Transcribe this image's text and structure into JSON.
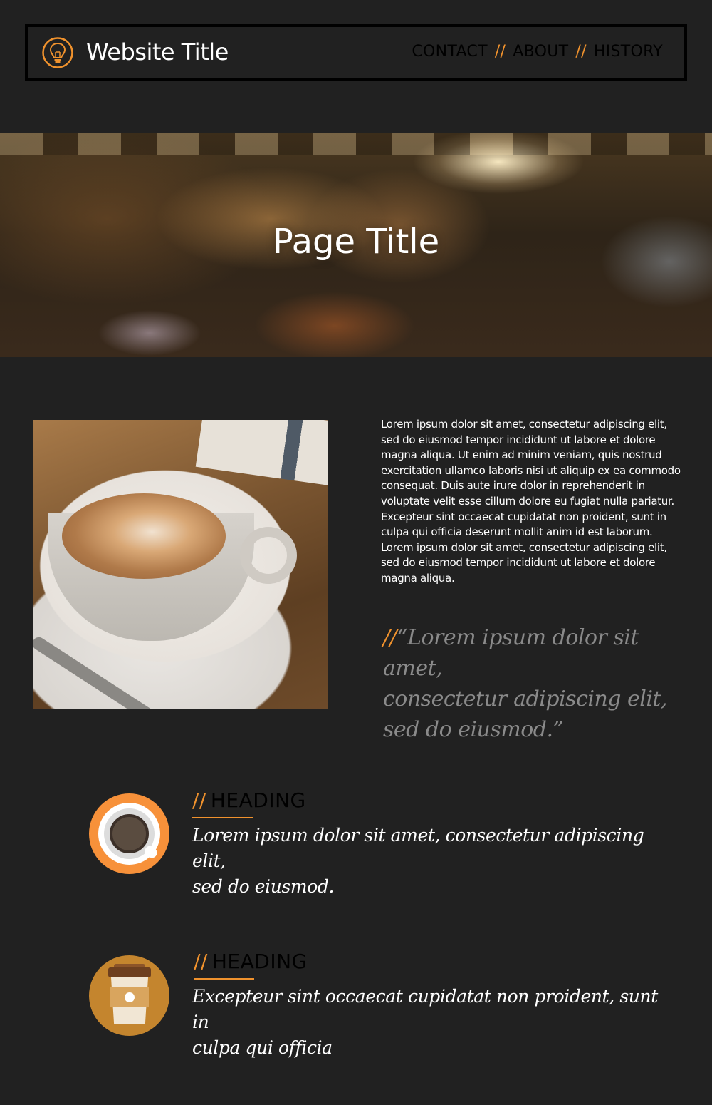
{
  "header": {
    "logo_icon": "lightbulb-icon",
    "site_title": "Website Title",
    "nav": {
      "items": [
        "CONTACT",
        "ABOUT",
        "HISTORY"
      ],
      "separator": "//"
    }
  },
  "hero": {
    "title": "Page Title",
    "background": "blurred-cafe-interior"
  },
  "main": {
    "image": "latte-art-coffee-cup",
    "body_text": "Lorem ipsum dolor sit amet, consectetur adipiscing elit, sed do eiusmod tempor incididunt ut labore et dolore magna aliqua. Ut enim ad minim veniam, quis nostrud exercitation ullamco laboris nisi ut aliquip ex ea commodo consequat. Duis aute irure dolor in reprehenderit in voluptate velit esse cillum dolore eu fugiat nulla pariatur. Excepteur sint occaecat cupidatat non proident, sunt in culpa qui officia deserunt mollit anim id est laborum. Lorem ipsum dolor sit amet, consectetur adipiscing elit, sed do eiusmod tempor incididunt ut labore et dolore magna aliqua.",
    "quote": {
      "mark": "//",
      "line1": "“Lorem ipsum dolor sit amet,",
      "line2": "consectetur adipiscing elit,",
      "line3": "sed do eiusmod.”"
    }
  },
  "features": [
    {
      "icon": "coffee-cup-icon",
      "mark": "//",
      "heading": "HEADING",
      "line1": "Lorem ipsum dolor sit amet, consectetur adipiscing elit,",
      "line2": "sed do eiusmod."
    },
    {
      "icon": "to-go-cup-icon",
      "mark": "//",
      "heading": "HEADING",
      "line1": "Excepteur sint occaecat cupidatat non proident, sunt in",
      "line2": "culpa qui officia"
    }
  ],
  "colors": {
    "background": "#212121",
    "accent": "#f0922d",
    "nav_text": "#000000",
    "quote_text": "#8a8a8a",
    "icon_orange": "#f7913a",
    "icon_brown": "#c4852e"
  }
}
